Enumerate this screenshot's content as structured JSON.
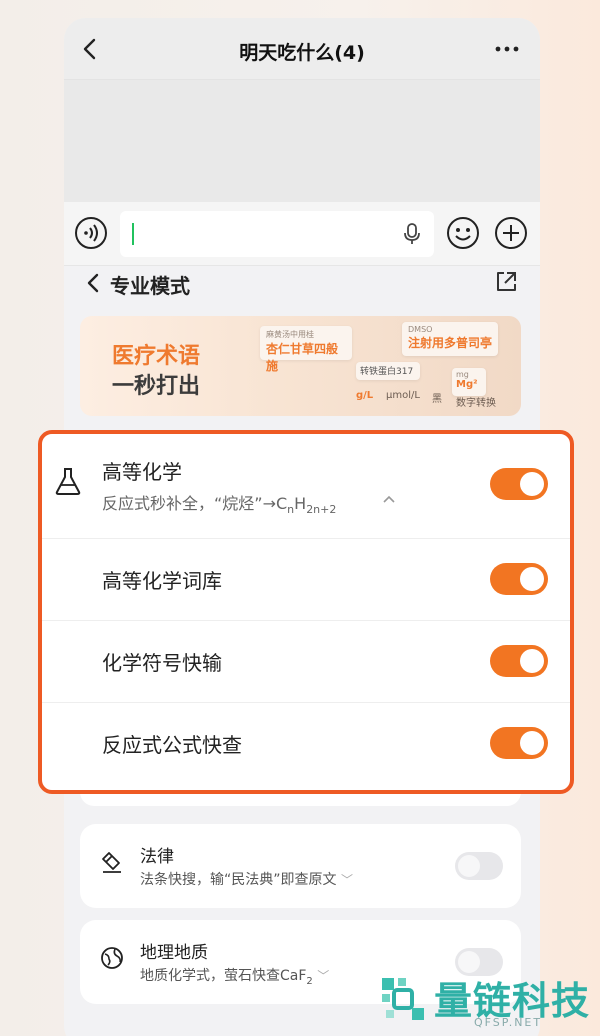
{
  "chat": {
    "title": "明天吃什么(4)"
  },
  "input": {
    "value": "",
    "placeholder": ""
  },
  "mode": {
    "title": "专业模式"
  },
  "banner": {
    "line1": "医疗术语",
    "line2": "一秒打出",
    "chips": [
      {
        "small": "麻黄汤中用桂",
        "big": "杏仁甘草四般施"
      },
      {
        "small": "DMSO",
        "big": "注射用多普司亭"
      },
      {
        "small": "",
        "big": "转铁蛋白317"
      },
      {
        "small": "mg",
        "big": "Mg²"
      }
    ],
    "units": [
      "g/L",
      "μmol/L",
      "黑",
      "数字转换"
    ]
  },
  "chemistry": {
    "title": "高等化学",
    "desc_prefix": "反应式秒补全，“烷烃”→C",
    "desc_sub_n": "n",
    "desc_h": "H",
    "desc_sub": "2n+2",
    "enabled": true,
    "rows": [
      {
        "label": "高等化学词库",
        "enabled": true
      },
      {
        "label": "化学符号快输",
        "enabled": true
      },
      {
        "label": "反应式公式快查",
        "enabled": true
      }
    ]
  },
  "law": {
    "title": "法律",
    "desc": "法条快搜，输“民法典”即查原文",
    "enabled": false
  },
  "geo": {
    "title": "地理地质",
    "desc": "地质化学式，萤石快查CaF",
    "desc_sub": "2",
    "enabled": false
  },
  "watermark": {
    "name": "量链科技",
    "url": "QFSP.NET"
  },
  "colors": {
    "accent": "#f27522",
    "highlight_border": "#ee5a24",
    "banner_orange": "#ef7a2f"
  },
  "icons": [
    "back-icon",
    "more-icon",
    "voice-icon",
    "mic-icon",
    "emoji-icon",
    "plus-icon",
    "share-icon",
    "flask-icon",
    "eraser-icon",
    "globe-icon"
  ]
}
